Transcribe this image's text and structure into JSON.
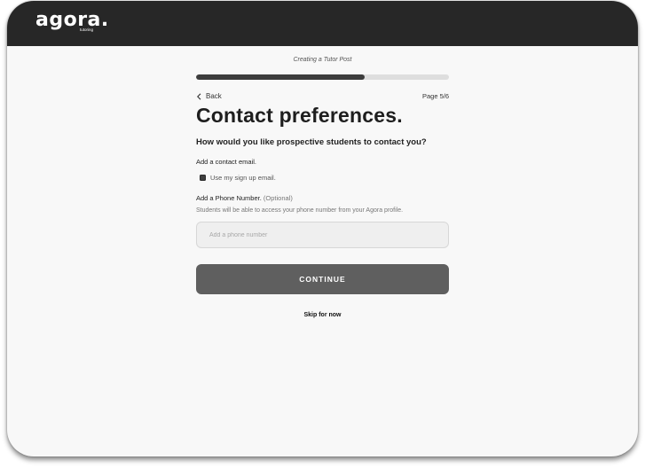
{
  "brand": {
    "logo_text": "agora.",
    "logo_subtext": "tutoring"
  },
  "flow": {
    "step_title": "Creating a Tutor Post",
    "progress_fraction": 0.667,
    "back_label": "Back",
    "page_indicator": "Page 5/6"
  },
  "form": {
    "heading": "Contact preferences.",
    "subheading": "How would you like prospective students to contact you?",
    "email_label": "Add a contact email.",
    "use_signup_email_label": "Use my sign up email.",
    "use_signup_email_checked": true,
    "phone_label": "Add a Phone Number.",
    "phone_optional": "(Optional)",
    "phone_hint": "Students will be able to access your phone number from your Agora profile.",
    "phone_value": "",
    "phone_placeholder": "Add a phone number",
    "continue_label": "CONTINUE",
    "skip_label": "Skip for now"
  },
  "colors": {
    "topbar": "#272727",
    "background": "#f8f8f8",
    "progress_fill": "#3d3d3d",
    "progress_track": "#dedede",
    "continue_button": "#5f5f5f"
  },
  "icons": {
    "back": "chevron-left-icon",
    "logo_pin": "location-pin-icon"
  }
}
